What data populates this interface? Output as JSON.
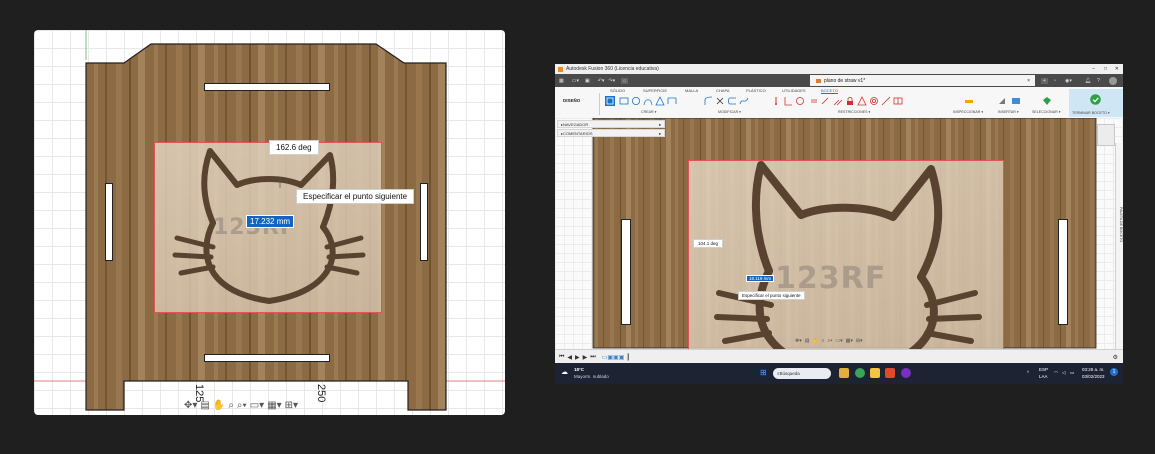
{
  "left": {
    "angle_label": "162.6 deg",
    "prompt_label": "Especificar el punto siguiente",
    "length_input": "17.232 mm",
    "watermark": "123RF",
    "dim_left": "125",
    "dim_right": "250"
  },
  "right": {
    "titlebar": {
      "title": "Autodesk Fusion 360 (Licencia educativa)",
      "min": "–",
      "max": "□",
      "close": "✕"
    },
    "document_tab": {
      "name": "plano de straw v1*",
      "close": "×"
    },
    "ribbon": {
      "tabs": [
        "SÓLIDO",
        "SUPERFICIE",
        "MALLA",
        "CHAPA",
        "PLÁSTICO",
        "UTILIDADES",
        "BOCETO"
      ],
      "active_tab": "BOCETO",
      "workspace": "DISEÑO",
      "groups": {
        "crear": "CREAR ▾",
        "modificar": "MODIFICAR ▾",
        "restricciones": "RESTRICCIONES ▾",
        "inspeccionar": "INSPECCIONAR ▾",
        "insertar": "INSERTAR ▾",
        "seleccionar": "SELECCIONAR ▾",
        "terminar": "TERMINAR BOCETO ▾"
      }
    },
    "browser": {
      "navegador": "NAVEGADOR",
      "comentarios": "COMENTARIOS"
    },
    "canvas": {
      "angle_label": "104.1 deg",
      "length_input": "18.119 mm",
      "prompt_label": "Especificar el punto siguiente",
      "watermark": "123RF",
      "palette_label": "PALETA DE BOCETO"
    },
    "taskbar": {
      "weather_temp": "18°C",
      "weather_desc": "Mayorm. nublado",
      "search_placeholder": "Búsqueda",
      "lang_line1": "ESP",
      "lang_line2": "LAA",
      "time": "03:28 a. m.",
      "date": "03/02/2023"
    },
    "colors": {
      "accent": "#1a73c9",
      "finish_green": "#2ea043",
      "taskbar": "#1d2333"
    }
  }
}
